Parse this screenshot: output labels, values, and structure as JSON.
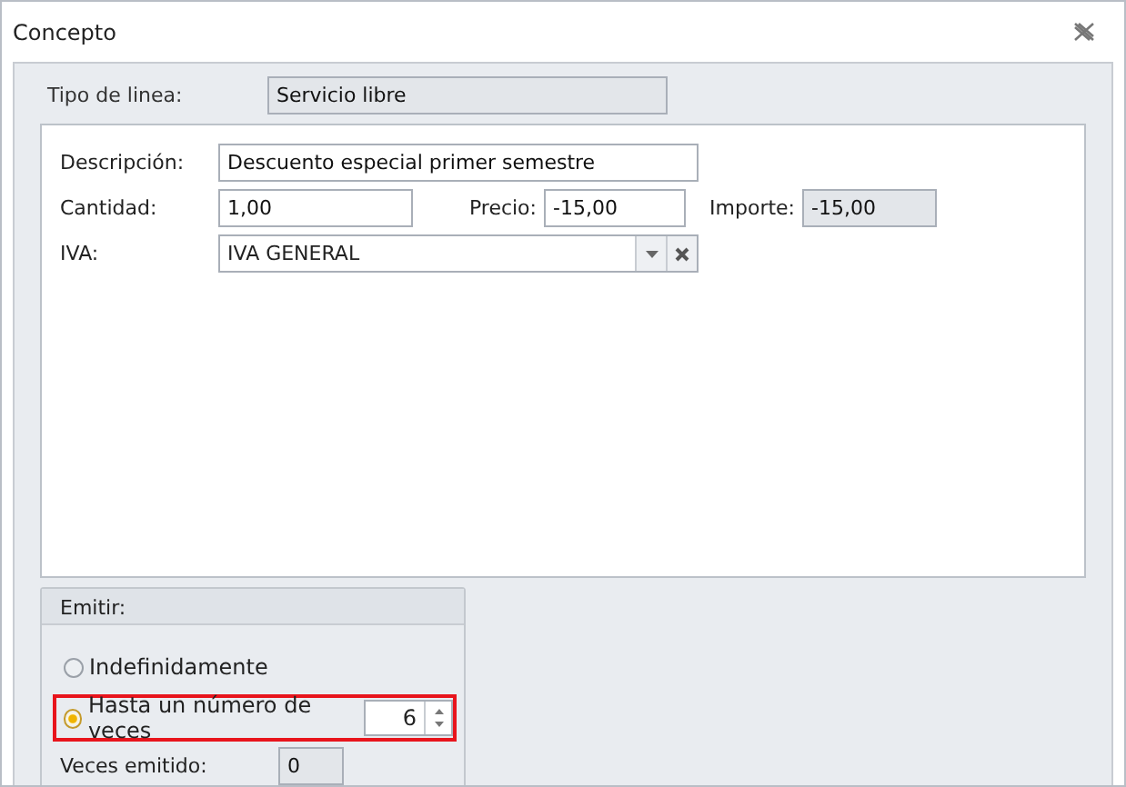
{
  "window": {
    "title": "Concepto"
  },
  "line_type": {
    "label": "Tipo de linea:",
    "value": "Servicio libre"
  },
  "description": {
    "label": "Descripción:",
    "value": "Descuento especial primer semestre"
  },
  "quantity": {
    "label": "Cantidad:",
    "value": "1,00"
  },
  "price": {
    "label": "Precio:",
    "value": "-15,00"
  },
  "amount": {
    "label": "Importe:",
    "value": "-15,00"
  },
  "vat": {
    "label": "IVA:",
    "value": "IVA GENERAL"
  },
  "emit": {
    "title": "Emitir:",
    "options": [
      {
        "label": "Indefinidamente",
        "selected": false
      },
      {
        "label": "Hasta un número de veces",
        "selected": true,
        "count": "6"
      }
    ],
    "emitted": {
      "label": "Veces emitido:",
      "value": "0"
    }
  }
}
